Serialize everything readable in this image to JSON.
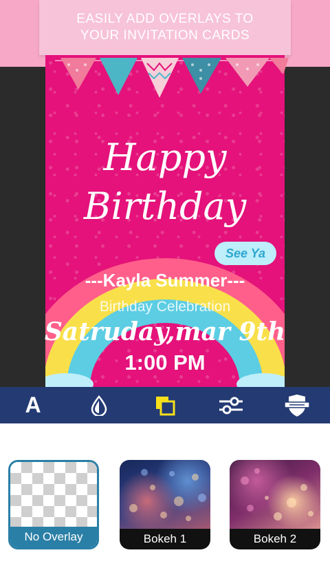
{
  "banner": {
    "line1": "EASILY ADD OVERLAYS TO",
    "line2": "YOUR INVITATION CARDS"
  },
  "card": {
    "title_line1": "Happy",
    "title_line2": "Birthday",
    "sticker": "See Ya",
    "name": "---Kayla Summer---",
    "subtitle": "Birthday Celebration",
    "date": "Satruday,mar  9th",
    "time": "1:00 PM",
    "background_color": "#e4127a"
  },
  "toolbar": {
    "background_color": "#233a73",
    "tools": [
      {
        "icon": "text-icon",
        "label": "A"
      },
      {
        "icon": "drop-icon"
      },
      {
        "icon": "overlay-icon"
      },
      {
        "icon": "sliders-icon"
      },
      {
        "icon": "badge-icon"
      }
    ]
  },
  "overlays": [
    {
      "label": "No Overlay",
      "selected": true
    },
    {
      "label": "Bokeh 1",
      "selected": false
    },
    {
      "label": "Bokeh 2",
      "selected": false
    }
  ]
}
